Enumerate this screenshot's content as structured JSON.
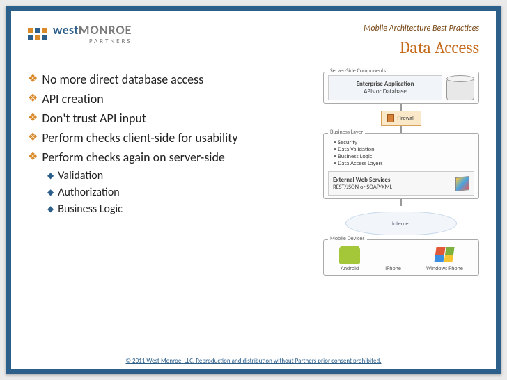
{
  "logo": {
    "brand_left": "west",
    "brand_right": "MONROE",
    "sub": "PARTNERS"
  },
  "supertitle": "Mobile Architecture Best Practices",
  "title": "Data Access",
  "bullets": [
    {
      "text": "No more direct database access"
    },
    {
      "text": "API creation"
    },
    {
      "text": "Don't trust API input"
    },
    {
      "text": "Perform checks client-side for usability"
    },
    {
      "text": "Perform checks again on server-side",
      "children": [
        {
          "text": "Validation"
        },
        {
          "text": "Authorization"
        },
        {
          "text": "Business Logic"
        }
      ]
    }
  ],
  "diagram": {
    "server_label": "Server-Side Components",
    "enterprise_title": "Enterprise Application",
    "enterprise_sub": "APIs or Database",
    "firewall": "Firewall",
    "business_label": "Business Layer",
    "business_items": [
      "Security",
      "Data Validation",
      "Business Logic",
      "Data Access Layers"
    ],
    "external_title": "External Web Services",
    "external_sub": "REST/JSON or SOAP/XML",
    "cloud": "Internet",
    "devices_label": "Mobile Devices",
    "devices": [
      "Android",
      "iPhone",
      "Windows Phone"
    ]
  },
  "footer": "© 2011 West Monroe, LLC.  Reproduction and distribution without Partners prior consent prohibited."
}
